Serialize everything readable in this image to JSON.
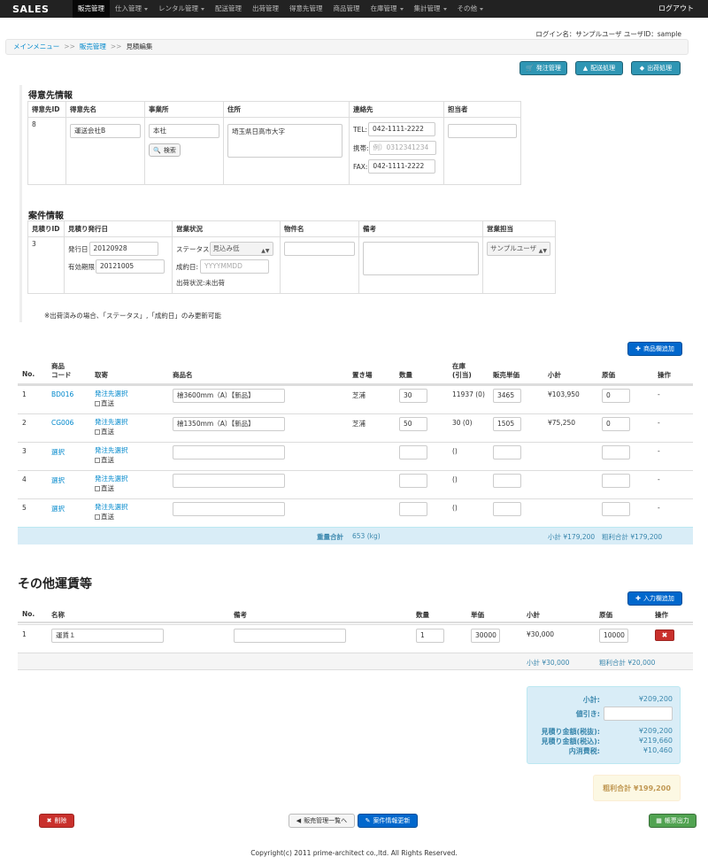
{
  "nav": {
    "brand": "SALES",
    "items": [
      {
        "label": "販売管理",
        "active": true,
        "dropdown": false
      },
      {
        "label": "仕入管理",
        "active": false,
        "dropdown": true
      },
      {
        "label": "レンタル管理",
        "active": false,
        "dropdown": true
      },
      {
        "label": "配送管理",
        "active": false,
        "dropdown": false
      },
      {
        "label": "出荷管理",
        "active": false,
        "dropdown": false
      },
      {
        "label": "得意先管理",
        "active": false,
        "dropdown": false
      },
      {
        "label": "商品管理",
        "active": false,
        "dropdown": false
      },
      {
        "label": "在庫管理",
        "active": false,
        "dropdown": true
      },
      {
        "label": "集計管理",
        "active": false,
        "dropdown": true
      },
      {
        "label": "その他",
        "active": false,
        "dropdown": true
      }
    ],
    "logout": "ログアウト"
  },
  "login_info": "ログイン名：サンプルユーザ ユーザID：sample",
  "breadcrumb": {
    "items": [
      "メインメニュー",
      "販売管理",
      "見積編集"
    ],
    "sep": ">>"
  },
  "top_buttons": {
    "order": "発注管理",
    "delivery": "配送処理",
    "shipping": "出荷処理"
  },
  "customer": {
    "title": "得意先情報",
    "headers": [
      "得意先ID",
      "得意先名",
      "事業所",
      "住所",
      "連絡先",
      "担当者"
    ],
    "id": "8",
    "name": "運送会社B",
    "office": "本社",
    "search_button": "検索",
    "address": "埼玉県日高市大字",
    "tel_label": "TEL:",
    "tel": "042-1111-2222",
    "mobile_label": "携帯:",
    "mobile_placeholder": "例）0312341234",
    "fax_label": "FAX:",
    "fax": "042-1111-2222",
    "staff": ""
  },
  "case": {
    "title": "案件情報",
    "headers": [
      "見積りID",
      "見積り発行日",
      "営業状況",
      "物件名",
      "備考",
      "営業担当"
    ],
    "id": "3",
    "issue_label": "発行日",
    "issue_date": "20120928",
    "expiry_label": "有効期限",
    "expiry_date": "20121005",
    "status_label": "ステータス",
    "status_value": "見込み低",
    "contract_label": "成約日:",
    "contract_placeholder": "YYYYMMDD",
    "ship_status": "出荷状況:未出荷",
    "property": "",
    "remarks": "",
    "sales_rep": "サンプルユーザ"
  },
  "note": "※出荷済みの場合、「ステータス」,「成約日」のみ更新可能",
  "products": {
    "add_button": "商品欄追加",
    "headers": {
      "no": "No.",
      "code1": "商品",
      "code2": "コード",
      "supplier": "取寄",
      "name": "商品名",
      "place": "置き場",
      "qty": "数量",
      "stock1": "在庫",
      "stock2": "(引当)",
      "price": "販売単価",
      "subtotal": "小計",
      "cost": "原価",
      "op": "操作"
    },
    "direct_label": "直送",
    "rows": [
      {
        "no": "1",
        "code": "BD016",
        "supplier": "発注先選択",
        "name": "檜3600mm（A）【新品】",
        "place": "芝浦",
        "qty": "30",
        "stock": "11937 (0)",
        "price": "3465",
        "subtotal": "¥103,950",
        "cost": "0",
        "op": "-"
      },
      {
        "no": "2",
        "code": "CG006",
        "supplier": "発注先選択",
        "name": "檜1350mm（A）【新品】",
        "place": "芝浦",
        "qty": "50",
        "stock": "30 (0)",
        "price": "1505",
        "subtotal": "¥75,250",
        "cost": "0",
        "op": "-"
      },
      {
        "no": "3",
        "code": "選択",
        "supplier": "発注先選択",
        "name": "",
        "place": "",
        "qty": "",
        "stock": "()",
        "price": "",
        "subtotal": "",
        "cost": "",
        "op": "-"
      },
      {
        "no": "4",
        "code": "選択",
        "supplier": "発注先選択",
        "name": "",
        "place": "",
        "qty": "",
        "stock": "()",
        "price": "",
        "subtotal": "",
        "cost": "",
        "op": "-"
      },
      {
        "no": "5",
        "code": "選択",
        "supplier": "発注先選択",
        "name": "",
        "place": "",
        "qty": "",
        "stock": "()",
        "price": "",
        "subtotal": "",
        "cost": "",
        "op": "-"
      }
    ],
    "weight_label": "重量合計",
    "weight_value": "653 (kg)",
    "subtotal_sum": "小計 ¥179,200",
    "profit_sum": "粗利合計 ¥179,200"
  },
  "freight": {
    "title": "その他運賃等",
    "add_button": "入力欄追加",
    "headers": {
      "no": "No.",
      "name": "名称",
      "remarks": "備考",
      "qty": "数量",
      "price": "単価",
      "subtotal": "小計",
      "cost": "原価",
      "op": "操作"
    },
    "rows": [
      {
        "no": "1",
        "name": "運賃１",
        "remarks": "",
        "qty": "1",
        "price": "30000",
        "subtotal": "¥30,000",
        "cost": "10000"
      }
    ],
    "subtotal_sum": "小計 ¥30,000",
    "profit_sum": "粗利合計 ¥20,000"
  },
  "totals": {
    "subtotal_label": "小計:",
    "subtotal": "¥209,200",
    "discount_label": "値引き:",
    "discount": "",
    "excl_label": "見積り金額(税抜):",
    "excl": "¥209,200",
    "incl_label": "見積り金額(税込):",
    "incl": "¥219,660",
    "tax_label": "内消費税:",
    "tax": "¥10,460",
    "profit": "粗利合計 ¥199,200"
  },
  "bottom_buttons": {
    "delete": "削除",
    "back": "販売管理一覧へ",
    "update": "案件情報更新",
    "print": "帳票出力"
  },
  "footer": "Copyright(c) 2011 prime-architect co.,ltd. All Rights Reserved.",
  "colors": {
    "navbar": "#222222",
    "info": "#2f96b4",
    "primary": "#0067cc",
    "danger": "#c9302c",
    "success": "#51a351",
    "link": "#0088cc"
  }
}
